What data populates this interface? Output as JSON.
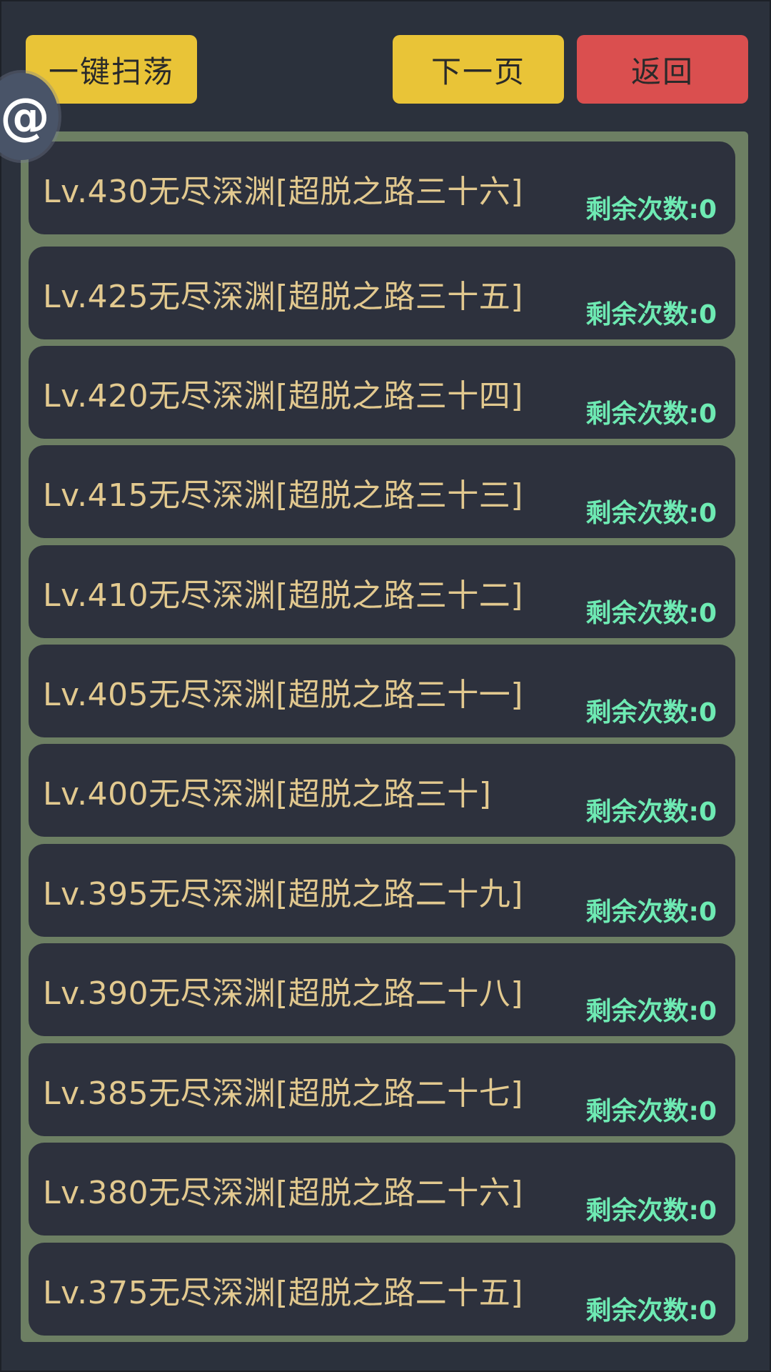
{
  "toolbar": {
    "sweep_label": "一键扫荡",
    "next_label": "下一页",
    "back_label": "返回"
  },
  "floating_button": {
    "icon": "at-icon",
    "glyph": "@"
  },
  "colors": {
    "background": "#2b313c",
    "panel": "#6d7f63",
    "row": "#2d313d",
    "title_text": "#e2c98f",
    "count_text": "#6eeab3",
    "yellow_button": "#e9c437",
    "red_button": "#da4f4f"
  },
  "levels": [
    {
      "title": "Lv.430无尽深渊[超脱之路三十六]",
      "count": "剩余次数:0"
    },
    {
      "title": "Lv.425无尽深渊[超脱之路三十五]",
      "count": "剩余次数:0"
    },
    {
      "title": "Lv.420无尽深渊[超脱之路三十四]",
      "count": "剩余次数:0"
    },
    {
      "title": "Lv.415无尽深渊[超脱之路三十三]",
      "count": "剩余次数:0"
    },
    {
      "title": "Lv.410无尽深渊[超脱之路三十二]",
      "count": "剩余次数:0"
    },
    {
      "title": "Lv.405无尽深渊[超脱之路三十一]",
      "count": "剩余次数:0"
    },
    {
      "title": "Lv.400无尽深渊[超脱之路三十]",
      "count": "剩余次数:0"
    },
    {
      "title": "Lv.395无尽深渊[超脱之路二十九]",
      "count": "剩余次数:0"
    },
    {
      "title": "Lv.390无尽深渊[超脱之路二十八]",
      "count": "剩余次数:0"
    },
    {
      "title": "Lv.385无尽深渊[超脱之路二十七]",
      "count": "剩余次数:0"
    },
    {
      "title": "Lv.380无尽深渊[超脱之路二十六]",
      "count": "剩余次数:0"
    },
    {
      "title": "Lv.375无尽深渊[超脱之路二十五]",
      "count": "剩余次数:0"
    }
  ]
}
